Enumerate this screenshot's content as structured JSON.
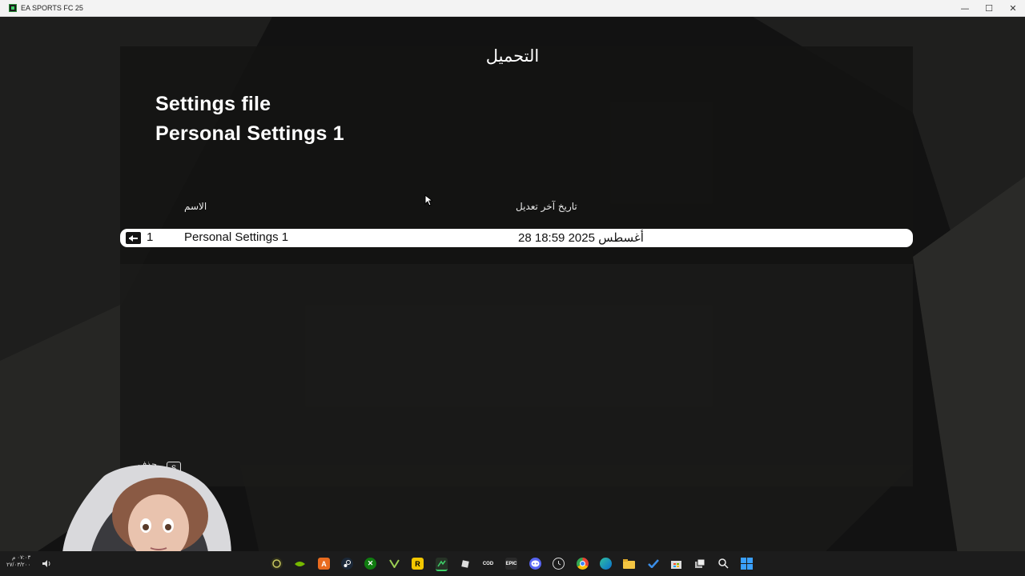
{
  "window": {
    "title": "EA SPORTS FC 25",
    "minimize": "—",
    "maximize": "☐",
    "close": "✕"
  },
  "screen": {
    "title": "التحميل",
    "heading_line1": "Settings file",
    "heading_line2": "Personal Settings 1"
  },
  "table": {
    "columns": {
      "name": "الاسم",
      "modified": "تاريخ آخر تعديل"
    },
    "rows": [
      {
        "number": "1",
        "name": "Personal Settings 1",
        "date": "28 أغسطس 2025 18:59"
      }
    ]
  },
  "overlay": {
    "key": "S",
    "key_label": "حذف"
  },
  "taskbar": {
    "time": "٠٧:٠٣ م",
    "date": "٢٧/٠٣/٢٠٠"
  },
  "colors": {
    "background": "#121212",
    "panel": "#141413",
    "row_highlight": "#ffffff",
    "text": "#ffffff",
    "taskbar": "#1c1c1c"
  }
}
